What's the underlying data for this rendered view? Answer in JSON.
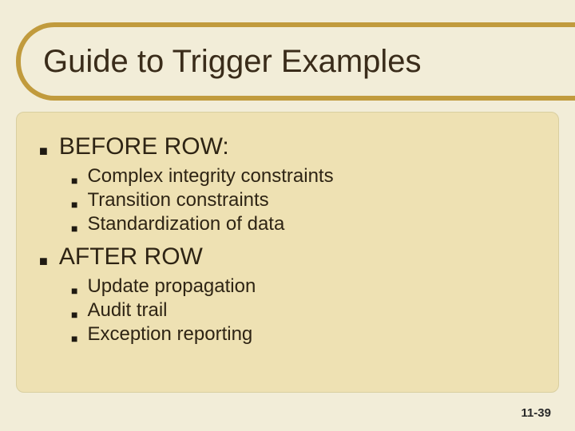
{
  "title": "Guide to Trigger Examples",
  "sections": [
    {
      "heading": "BEFORE ROW:",
      "items": [
        "Complex integrity constraints",
        "Transition constraints",
        "Standardization of data"
      ]
    },
    {
      "heading": "AFTER ROW",
      "items": [
        "Update propagation",
        "Audit trail",
        "Exception reporting"
      ]
    }
  ],
  "page_number": "11-39"
}
